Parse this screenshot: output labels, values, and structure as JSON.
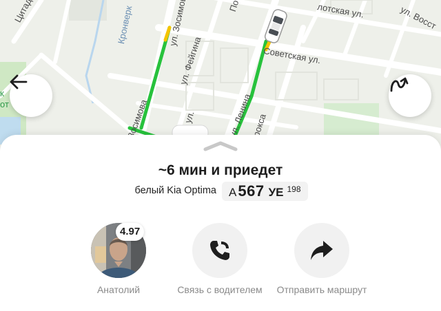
{
  "map": {
    "streets": {
      "tsitadelnaya": "Цитадельн",
      "kronverkskaya": "Кронверк",
      "zosimova_top": "ул. Зосимова",
      "zosimova_bottom": "Зосимова",
      "feigina": "ул. Фейгина",
      "lenina": "ул. Ленина",
      "sovetskaya": "Советская ул.",
      "flotskaya": "лотская ул.",
      "vosstaniya": "ул. Восст",
      "po_cut": "По",
      "ul_cut_left": "ул.",
      "roksa": "рокса",
      "left_cut": "к\nот"
    },
    "back_icon": "arrow-left-icon",
    "route_icon": "route-icon",
    "colors": {
      "route_green": "#27c23c",
      "route_yellow": "#f5c400",
      "park": "#cfe8c4"
    }
  },
  "sheet": {
    "eta": "~6 мин и приедет",
    "car_description": "белый Kia Optima",
    "plate": {
      "letter1": "А",
      "number": "567",
      "letters2": "УЕ",
      "region": "198"
    }
  },
  "driver": {
    "name": "Анатолий",
    "rating": "4.97"
  },
  "actions": {
    "call_label": "Связь с водителем",
    "share_label": "Отправить маршрут"
  }
}
